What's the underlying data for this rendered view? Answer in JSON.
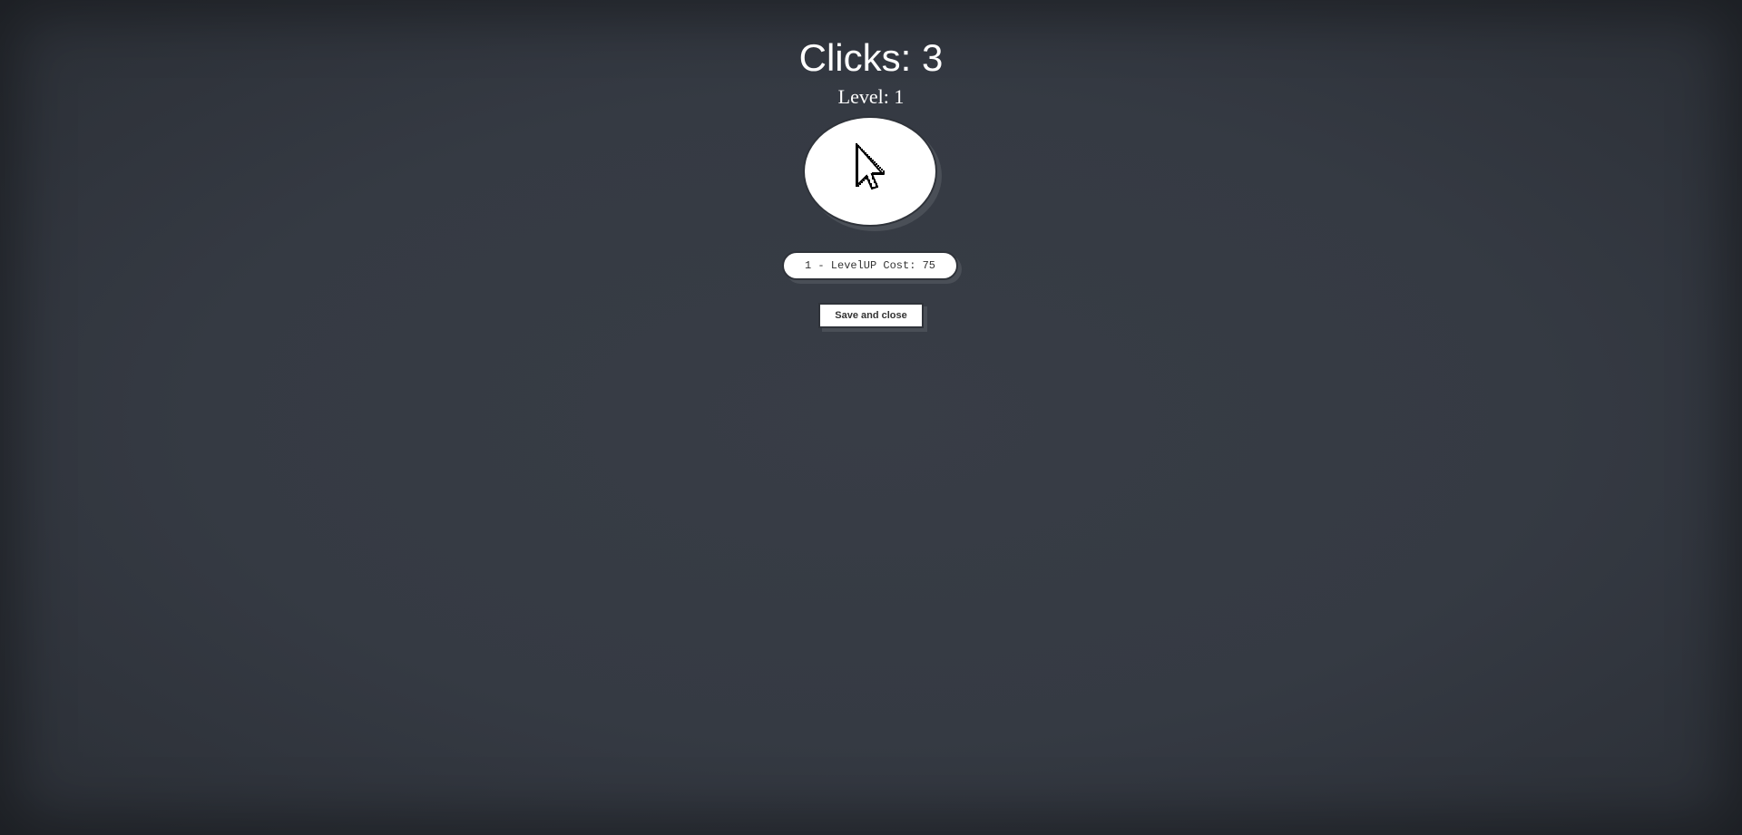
{
  "stats": {
    "clicks_text": "Clicks: 3",
    "level_text": "Level: 1"
  },
  "click_button": {
    "icon": "mouse-pointer-icon"
  },
  "upgrade_button": {
    "label": "1 - LevelUP Cost: 75"
  },
  "save_button": {
    "label": "Save and close"
  },
  "colors": {
    "background": "#353a43",
    "button_fill": "#ffffff",
    "button_shadow": "#4a4f57",
    "text": "#ffffff"
  }
}
